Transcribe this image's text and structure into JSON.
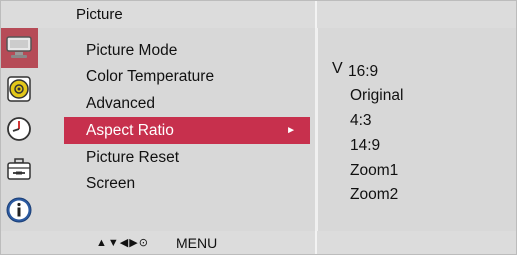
{
  "header": {
    "title": "Picture"
  },
  "sidebar": {
    "icons": [
      {
        "name": "picture-icon",
        "active": true
      },
      {
        "name": "sound-icon",
        "active": false
      },
      {
        "name": "time-icon",
        "active": false
      },
      {
        "name": "option-icon",
        "active": false
      },
      {
        "name": "information-icon",
        "active": false
      }
    ]
  },
  "menu": {
    "items": [
      {
        "label": "Picture Mode"
      },
      {
        "label": "Color Temperature"
      },
      {
        "label": "Advanced"
      },
      {
        "label": "Aspect Ratio",
        "selected": true
      },
      {
        "label": "Picture Reset"
      },
      {
        "label": "Screen"
      }
    ],
    "arrow_glyph": "►"
  },
  "options": {
    "checkmark": "V",
    "items": [
      {
        "label": "16:9",
        "checked": true
      },
      {
        "label": "Original"
      },
      {
        "label": "4:3"
      },
      {
        "label": "14:9"
      },
      {
        "label": "Zoom1"
      },
      {
        "label": "Zoom2"
      }
    ]
  },
  "footer": {
    "nav_glyphs": "▲▼◀▶⊙",
    "menu_label": "MENU"
  },
  "colors": {
    "selected_bg": "#c7304d",
    "active_icon_bg": "#b64b57",
    "panel_bg": "#d8d8d8"
  }
}
